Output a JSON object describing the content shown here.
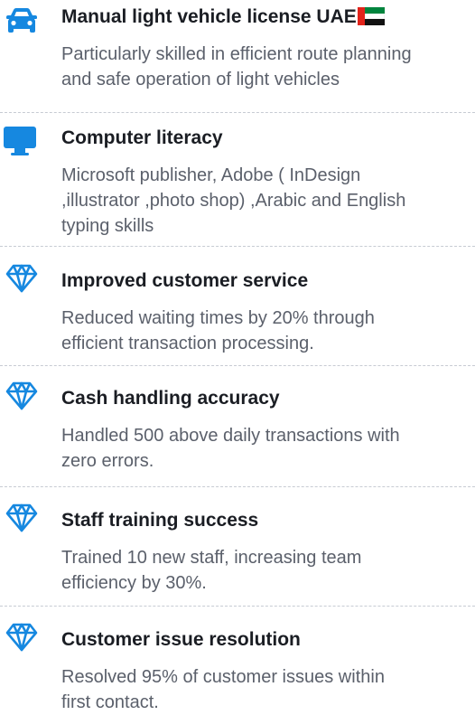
{
  "colors": {
    "icon_blue": "#1688e0",
    "title": "#1a1d23",
    "description": "#5b606b",
    "divider": "#c7cbd3"
  },
  "items": [
    {
      "icon": "car-icon",
      "title": "Manual light vehicle license UAE",
      "flag": "uae-flag-icon",
      "lines": [
        "Particularly skilled in efficient route planning",
        "and safe operation of light vehicles"
      ]
    },
    {
      "icon": "monitor-icon",
      "title": "Computer literacy",
      "lines": [
        "Microsoft publisher,  Adobe ( InDesign",
        ",illustrator ,photo shop) ,Arabic and English",
        "typing skills"
      ]
    },
    {
      "icon": "diamond-icon",
      "title": "Improved customer service",
      "lines": [
        "Reduced waiting times by 20% through",
        "efficient transaction processing."
      ]
    },
    {
      "icon": "diamond-icon",
      "title": "Cash handling accuracy",
      "lines": [
        "Handled 500 above daily transactions with",
        "zero errors."
      ]
    },
    {
      "icon": "diamond-icon",
      "title": "Staff training success",
      "lines": [
        "Trained 10 new staff, increasing team",
        "efficiency by 30%."
      ]
    },
    {
      "icon": "diamond-icon",
      "title": "Customer issue resolution",
      "lines": [
        "Resolved 95% of customer issues within",
        "first contact."
      ]
    }
  ]
}
